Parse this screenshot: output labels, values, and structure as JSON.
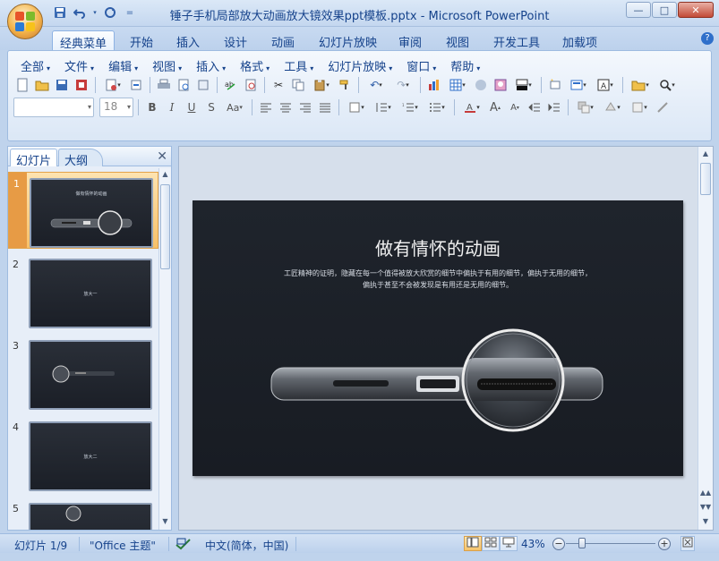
{
  "window": {
    "title": "锤子手机局部放大动画放大镜效果ppt模板.pptx - Microsoft PowerPoint",
    "controls": [
      "—",
      "□",
      "✕"
    ]
  },
  "quick_access": {
    "save_icon": "save-icon",
    "undo_icon": "undo-icon",
    "redo_icon": "redo-icon",
    "more_glyph": "="
  },
  "ribbon_tabs": [
    "经典菜单",
    "开始",
    "插入",
    "设计",
    "动画",
    "幻灯片放映",
    "审阅",
    "视图",
    "开发工具",
    "加载项"
  ],
  "menu_bar": [
    "全部",
    "文件",
    "编辑",
    "视图",
    "插入",
    "格式",
    "工具",
    "幻灯片放映",
    "窗口",
    "帮助"
  ],
  "format_row": {
    "font_name": "",
    "font_size": "18",
    "bold": "B",
    "italic": "I",
    "underline": "U",
    "shadow": "S",
    "case": "Aa"
  },
  "left_pane": {
    "tabs": [
      "幻灯片",
      "大纲"
    ],
    "close": "✕",
    "slides": [
      {
        "num": "1",
        "selected": true,
        "caption": "做有情怀的动画"
      },
      {
        "num": "2",
        "selected": false,
        "caption": "放大一"
      },
      {
        "num": "3",
        "selected": false,
        "caption": ""
      },
      {
        "num": "4",
        "selected": false,
        "caption": "放大二"
      },
      {
        "num": "5",
        "selected": false,
        "caption": ""
      }
    ]
  },
  "slide": {
    "title": "做有情怀的动画",
    "subtitle_line1": "工匠精神的证明，隐藏在每一个值得被放大欣赏的细节中偏执于有用的细节，偏执于无用的细节，",
    "subtitle_line2": "偏执于甚至不会被发现是有用还是无用的细节。"
  },
  "status_bar": {
    "slide_info": "幻灯片 1/9",
    "theme": "\"Office 主题\"",
    "language": "中文(简体，中国)",
    "zoom": "43%",
    "zoom_level": 0.43
  }
}
